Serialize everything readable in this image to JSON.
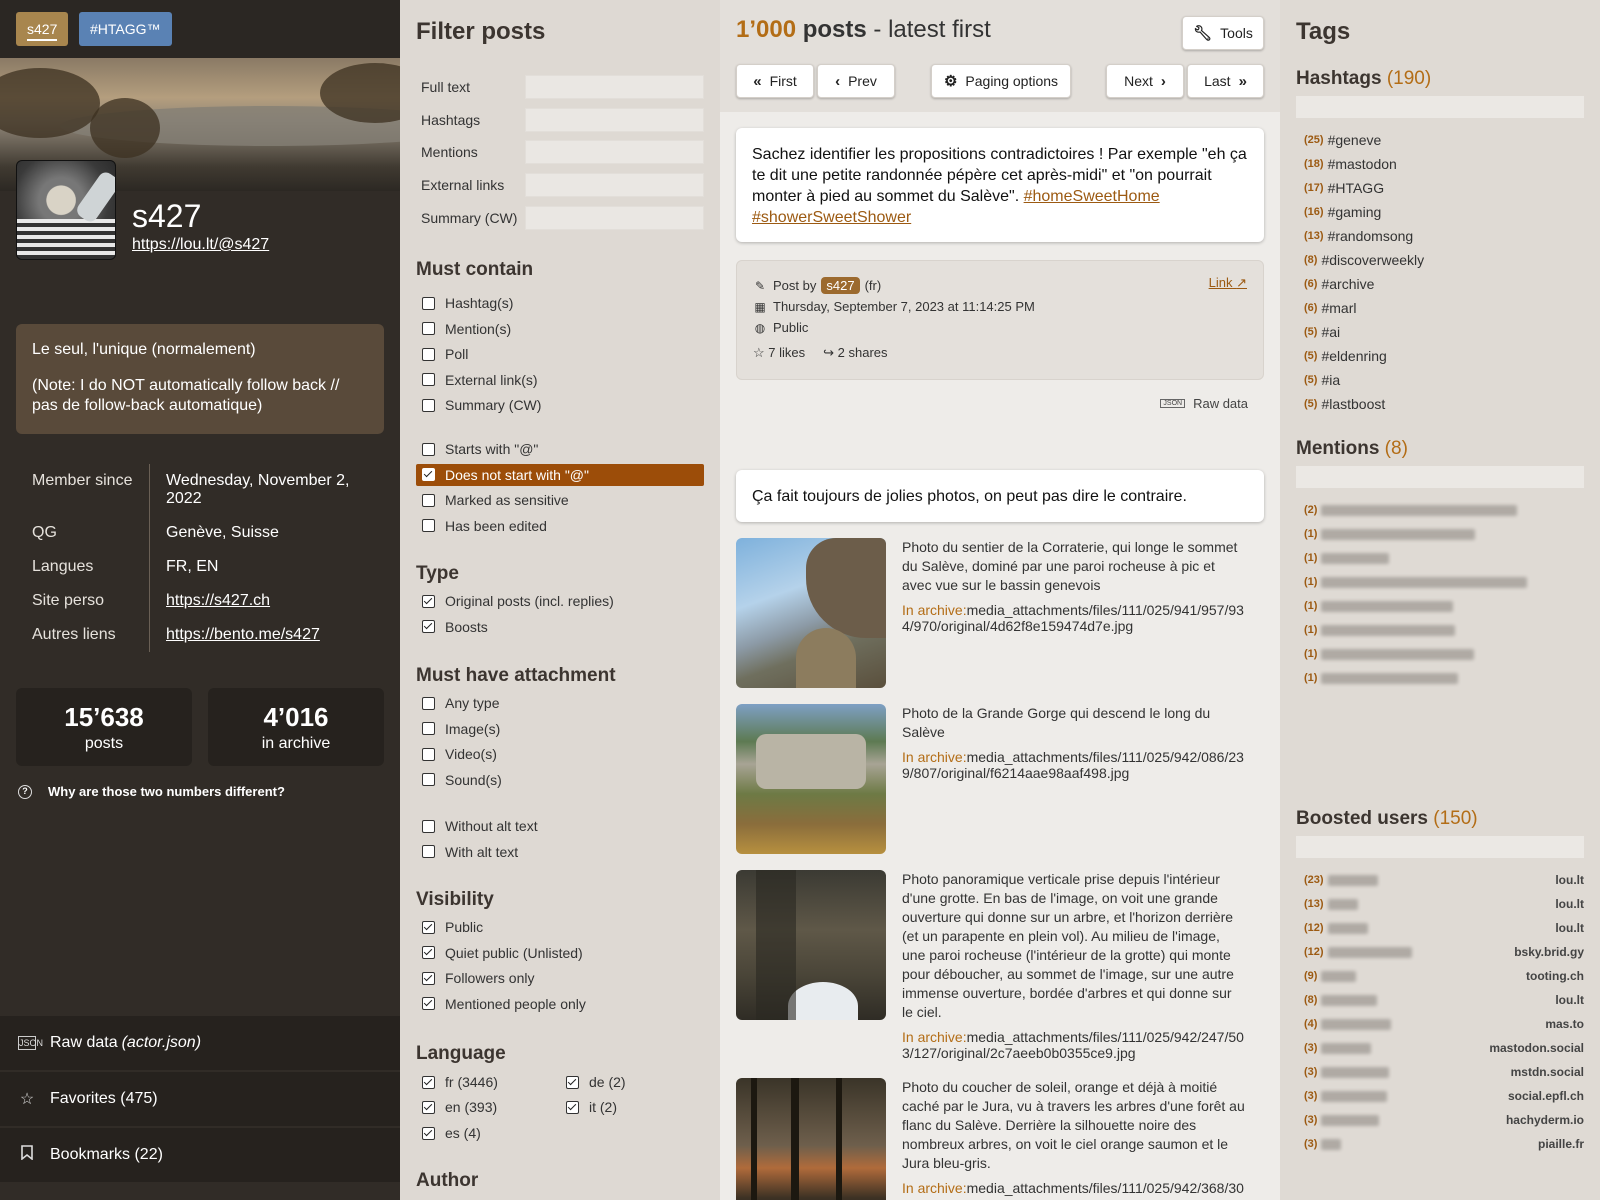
{
  "profile": {
    "chip_user": "s427",
    "chip_htagg": "#HTAGG™",
    "name": "s427",
    "url": "https://lou.lt/@s427",
    "bio": [
      "Le seul, l'unique (normalement)",
      "(Note: I do NOT automatically follow back // pas de follow-back automatique)"
    ],
    "fields": [
      {
        "name": "Member since",
        "value": "Wednesday, November 2, 2022",
        "link": false
      },
      {
        "name": "QG",
        "value": "Genève, Suisse",
        "link": false
      },
      {
        "name": "Langues",
        "value": "FR, EN",
        "link": false
      },
      {
        "name": "Site perso",
        "value": "https://s427.ch",
        "link": true
      },
      {
        "name": "Autres liens",
        "value": "https://bento.me/s427",
        "link": true
      }
    ],
    "stat_posts": {
      "value": "15’638",
      "label": "posts"
    },
    "stat_archive": {
      "value": "4’016",
      "label": "in archive"
    },
    "why": "Why are those two numbers different?",
    "raw_label": "Raw data",
    "raw_file": "(actor.json)",
    "favorites": "Favorites (475)",
    "bookmarks": "Bookmarks (22)"
  },
  "filters": {
    "title": "Filter posts",
    "text_fields": [
      "Full text",
      "Hashtags",
      "Mentions",
      "External links",
      "Summary (CW)"
    ],
    "must_contain_title": "Must contain",
    "must_contain": [
      {
        "label": "Hashtag(s)",
        "checked": false
      },
      {
        "label": "Mention(s)",
        "checked": false
      },
      {
        "label": "Poll",
        "checked": false
      },
      {
        "label": "External link(s)",
        "checked": false
      },
      {
        "label": "Summary (CW)",
        "checked": false
      }
    ],
    "start_opts": [
      {
        "label": "Starts with \"@\"",
        "checked": false,
        "highlight": false
      },
      {
        "label": "Does not start with \"@\"",
        "checked": true,
        "highlight": true
      },
      {
        "label": "Marked as sensitive",
        "checked": false,
        "highlight": false
      },
      {
        "label": "Has been edited",
        "checked": false,
        "highlight": false
      }
    ],
    "type_title": "Type",
    "types": [
      {
        "label": "Original posts (incl. replies)",
        "checked": true
      },
      {
        "label": "Boosts",
        "checked": true
      }
    ],
    "attachment_title": "Must have attachment",
    "attachments": [
      {
        "label": "Any type",
        "checked": false
      },
      {
        "label": "Image(s)",
        "checked": false
      },
      {
        "label": "Video(s)",
        "checked": false
      },
      {
        "label": "Sound(s)",
        "checked": false
      }
    ],
    "alt_opts": [
      {
        "label": "Without alt text",
        "checked": false
      },
      {
        "label": "With alt text",
        "checked": false
      }
    ],
    "visibility_title": "Visibility",
    "visibility": [
      {
        "label": "Public",
        "checked": true
      },
      {
        "label": "Quiet public (Unlisted)",
        "checked": true
      },
      {
        "label": "Followers only",
        "checked": true
      },
      {
        "label": "Mentioned people only",
        "checked": true
      }
    ],
    "language_title": "Language",
    "languages": [
      {
        "label": "fr (3446)",
        "checked": true
      },
      {
        "label": "de (2)",
        "checked": true
      },
      {
        "label": "en (393)",
        "checked": true
      },
      {
        "label": "it (2)",
        "checked": true
      },
      {
        "label": "es (4)",
        "checked": true
      }
    ],
    "author_title": "Author"
  },
  "posts": {
    "count": "1’000",
    "count_label": "posts",
    "order": "- latest first",
    "tools": "Tools",
    "nav": {
      "first": "First",
      "prev": "Prev",
      "paging": "Paging options",
      "next": "Next",
      "last": "Last"
    },
    "post1": {
      "text": "Sachez identifier les propositions contradictoires ! Par exemple \"eh ça te dit une petite randonnée pépère cet après-midi\" et \"on pourrait monter à pied au sommet du Salève\".",
      "tags": [
        "#homeSweetHome",
        "#showerSweetShower"
      ],
      "post_by": "Post by",
      "author": "s427",
      "lang": "(fr)",
      "date": "Thursday, September 7, 2023 at 11:14:25 PM",
      "visibility": "Public",
      "link": "Link",
      "likes": "7 likes",
      "shares": "2 shares",
      "raw": "Raw data"
    },
    "post2": {
      "text": "Ça fait toujours de jolies photos, on peut pas dire le contraire.",
      "in_archive": "In archive:",
      "attachments": [
        {
          "desc": "Photo du sentier de la Corraterie, qui longe le sommet du Salève, dominé par une paroi rocheuse à pic et avec vue sur le bassin genevois",
          "path": "media_attachments/files/111/025/941/957/934/970/original/4d62f8e159474d7e.jpg"
        },
        {
          "desc": "Photo de la Grande Gorge qui descend le long du Salève",
          "path": "media_attachments/files/111/025/942/086/239/807/original/f6214aae98aaf498.jpg"
        },
        {
          "desc": "Photo panoramique verticale prise depuis l'intérieur d'une grotte. En bas de l'image, on voit une grande ouverture qui donne sur un arbre, et l'horizon derrière (et un parapente en plein vol). Au milieu de l'image, une paroi rocheuse (l'intérieur de la grotte) qui monte pour déboucher, au sommet de l'image, sur une autre immense ouverture, bordée d'arbres et qui donne sur le ciel.",
          "path": "media_attachments/files/111/025/942/247/503/127/original/2c7aeeb0b0355ce9.jpg"
        },
        {
          "desc": "Photo du coucher de soleil, orange et déjà à moitié caché par le Jura, vu à travers les arbres d'une forêt au flanc du Salève. Derrière la silhouette noire des nombreux arbres, on voit le ciel orange saumon et le Jura bleu-gris.",
          "path": "media_attachments/files/111/025/942/368/30"
        }
      ]
    }
  },
  "tags": {
    "title": "Tags",
    "hashtags_title": "Hashtags",
    "hashtags_count": "(190)",
    "hashtags": [
      {
        "c": "(25)",
        "t": "#geneve"
      },
      {
        "c": "(18)",
        "t": "#mastodon"
      },
      {
        "c": "(17)",
        "t": "#HTAGG"
      },
      {
        "c": "(16)",
        "t": "#gaming"
      },
      {
        "c": "(13)",
        "t": "#randomsong"
      },
      {
        "c": "(8)",
        "t": "#discoverweekly"
      },
      {
        "c": "(6)",
        "t": "#archive"
      },
      {
        "c": "(6)",
        "t": "#marl"
      },
      {
        "c": "(5)",
        "t": "#ai"
      },
      {
        "c": "(5)",
        "t": "#eldenring"
      },
      {
        "c": "(5)",
        "t": "#ia"
      },
      {
        "c": "(5)",
        "t": "#lastboost"
      }
    ],
    "mentions_title": "Mentions",
    "mentions_count": "(8)",
    "mentions": [
      "(2)",
      "(1)",
      "(1)",
      "(1)",
      "(1)",
      "(1)",
      "(1)",
      "(1)"
    ],
    "boosted_title": "Boosted users",
    "boosted_count": "(150)",
    "boosted": [
      {
        "c": "(23)",
        "i": "lou.lt"
      },
      {
        "c": "(13)",
        "i": "lou.lt"
      },
      {
        "c": "(12)",
        "i": "lou.lt"
      },
      {
        "c": "(12)",
        "i": "bsky.brid.gy"
      },
      {
        "c": "(9)",
        "i": "tooting.ch"
      },
      {
        "c": "(8)",
        "i": "lou.lt"
      },
      {
        "c": "(4)",
        "i": "mas.to"
      },
      {
        "c": "(3)",
        "i": "mastodon.social"
      },
      {
        "c": "(3)",
        "i": "mstdn.social"
      },
      {
        "c": "(3)",
        "i": "social.epfl.ch"
      },
      {
        "c": "(3)",
        "i": "hachyderm.io"
      },
      {
        "c": "(3)",
        "i": "piaille.fr"
      }
    ]
  }
}
